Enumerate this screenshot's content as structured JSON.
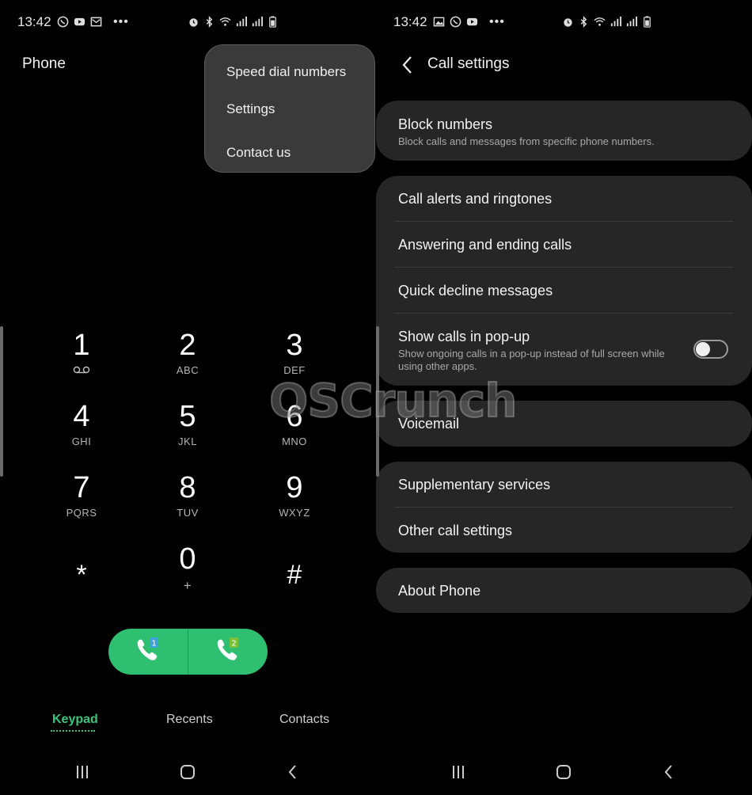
{
  "left_screen": {
    "status": {
      "time": "13:42"
    },
    "title": "Phone",
    "menu": {
      "items": [
        {
          "label": "Speed dial numbers"
        },
        {
          "label": "Settings"
        },
        {
          "label": "Contact us"
        }
      ]
    },
    "keypad": {
      "keys": [
        {
          "digit": "1",
          "letters": ""
        },
        {
          "digit": "2",
          "letters": "ABC"
        },
        {
          "digit": "3",
          "letters": "DEF"
        },
        {
          "digit": "4",
          "letters": "GHI"
        },
        {
          "digit": "5",
          "letters": "JKL"
        },
        {
          "digit": "6",
          "letters": "MNO"
        },
        {
          "digit": "7",
          "letters": "PQRS"
        },
        {
          "digit": "8",
          "letters": "TUV"
        },
        {
          "digit": "9",
          "letters": "WXYZ"
        },
        {
          "digit": "*",
          "letters": ""
        },
        {
          "digit": "0",
          "letters": "+"
        },
        {
          "digit": "#",
          "letters": ""
        }
      ]
    },
    "call_buttons": [
      {
        "sim": "1",
        "icon": "phone-sim1-icon"
      },
      {
        "sim": "2",
        "icon": "phone-sim2-icon"
      }
    ],
    "tabs": [
      {
        "label": "Keypad",
        "active": true
      },
      {
        "label": "Recents",
        "active": false
      },
      {
        "label": "Contacts",
        "active": false
      }
    ]
  },
  "right_screen": {
    "status": {
      "time": "13:42"
    },
    "title": "Call settings",
    "groups": [
      {
        "rows": [
          {
            "title": "Block numbers",
            "subtitle": "Block calls and messages from specific phone numbers."
          }
        ]
      },
      {
        "rows": [
          {
            "title": "Call alerts and ringtones"
          },
          {
            "title": "Answering and ending calls"
          },
          {
            "title": "Quick decline messages"
          },
          {
            "title": "Show calls in pop-up",
            "subtitle": "Show ongoing calls in a pop-up instead of full screen while using other apps.",
            "toggle": "off"
          }
        ]
      },
      {
        "rows": [
          {
            "title": "Voicemail"
          }
        ]
      },
      {
        "rows": [
          {
            "title": "Supplementary services"
          },
          {
            "title": "Other call settings"
          }
        ]
      },
      {
        "rows": [
          {
            "title": "About Phone"
          }
        ]
      }
    ]
  },
  "watermark": "OSCrunch",
  "colors": {
    "accent_green": "#2fbf71",
    "tab_active": "#3cc57a",
    "card_bg": "#262626",
    "menu_bg": "#3a3a3a"
  }
}
